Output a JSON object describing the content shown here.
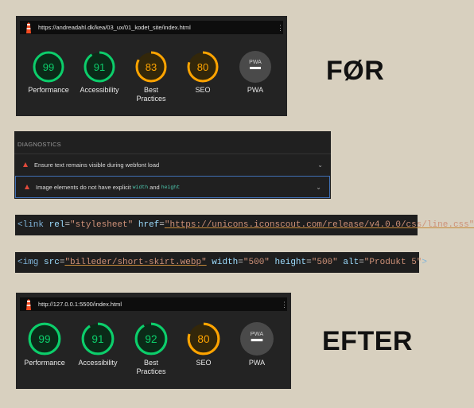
{
  "before": {
    "url": "https://andreadahl.dk/kea/03_ux/01_kodet_site/index.html",
    "heading": "FØR",
    "gauges": [
      {
        "score": "99",
        "label": "Performance",
        "color": "#0cce6b"
      },
      {
        "score": "91",
        "label": "Accessibility",
        "color": "#0cce6b"
      },
      {
        "score": "83",
        "label": "Best Practices",
        "label_line1": "Best",
        "label_line2": "Practices",
        "color": "#ffa400"
      },
      {
        "score": "80",
        "label": "SEO",
        "color": "#ffa400"
      },
      {
        "score": "PWA",
        "label": "PWA",
        "color": "#9aa0a6"
      }
    ]
  },
  "diagnostics": {
    "title": "DIAGNOSTICS",
    "items": [
      {
        "text": "Ensure text remains visible during webfont load"
      },
      {
        "text_pre": "Image elements do not have explicit",
        "code1": "width",
        "text_mid": "and",
        "code2": "height"
      }
    ]
  },
  "code_link": {
    "open": "<link",
    "attr1": "rel",
    "val1": "\"stylesheet\"",
    "attr2": "href",
    "val2": "\"https://unicons.iconscout.com/release/v4.0.0/css/line.css\"",
    "close": ">"
  },
  "code_img": {
    "open": "<img",
    "attr1": "src",
    "val1": "\"billeder/short-skirt.webp\"",
    "attr2": "width",
    "val2": "\"500\"",
    "attr3": "height",
    "val3": "\"500\"",
    "attr4": "alt",
    "val4": "\"Produkt 5\"",
    "close": ">"
  },
  "after": {
    "url": "http://127.0.0.1:5500/index.html",
    "heading": "EFTER",
    "gauges": [
      {
        "score": "99",
        "label": "Performance",
        "color": "#0cce6b"
      },
      {
        "score": "91",
        "label": "Accessibility",
        "color": "#0cce6b"
      },
      {
        "score": "92",
        "label": "Best Practices",
        "label_line1": "Best",
        "label_line2": "Practices",
        "color": "#0cce6b"
      },
      {
        "score": "80",
        "label": "SEO",
        "color": "#ffa400"
      },
      {
        "score": "PWA",
        "label": "PWA",
        "color": "#9aa0a6"
      }
    ]
  }
}
